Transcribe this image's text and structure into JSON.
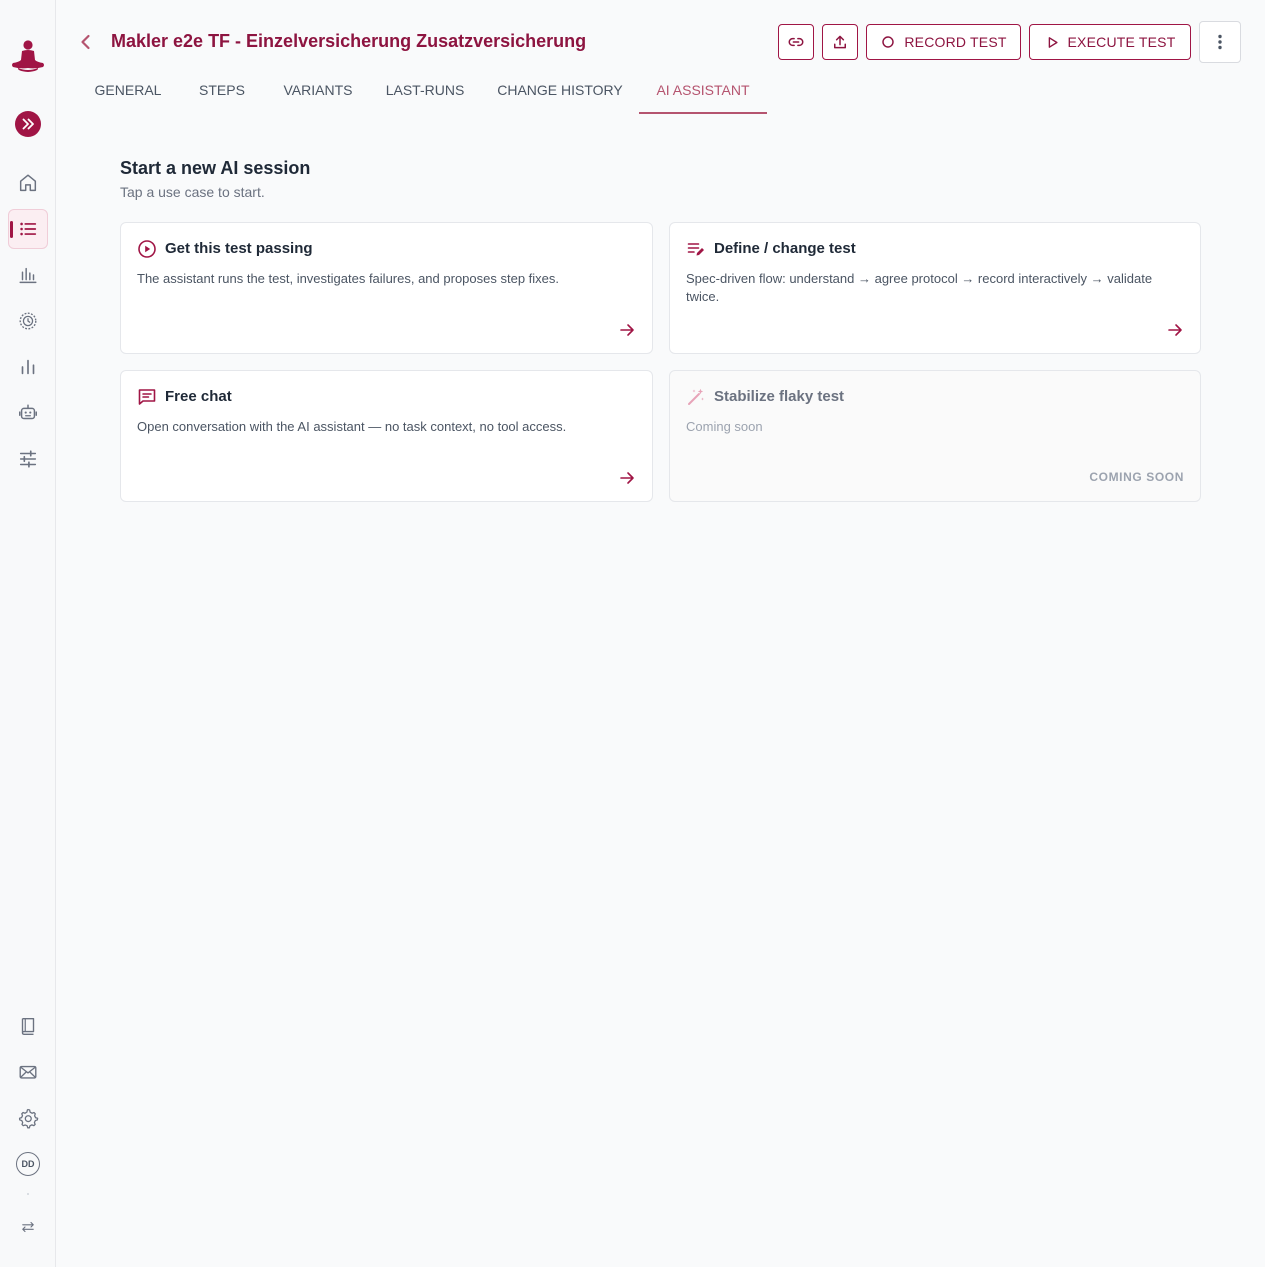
{
  "colors": {
    "brand": "#8d1440",
    "accent": "#a01545",
    "tab_active": "#b5546f",
    "icon_gray": "#6b7280"
  },
  "sidebar": {
    "logo_icon": "meditating-person-logo",
    "top_items": [
      {
        "icon": "home-icon",
        "active": false
      },
      {
        "icon": "list-icon",
        "active": true
      },
      {
        "icon": "bar-chart-icon",
        "active": false
      },
      {
        "icon": "clock-badge-icon",
        "active": false
      },
      {
        "icon": "analytics-icon",
        "active": false
      },
      {
        "icon": "robot-icon",
        "active": false
      },
      {
        "icon": "sliders-icon",
        "active": false
      }
    ],
    "bottom_items": [
      {
        "icon": "book-icon"
      },
      {
        "icon": "mail-icon"
      },
      {
        "icon": "gear-icon"
      }
    ],
    "avatar_initials": "DD"
  },
  "header": {
    "title": "Makler e2e TF - Einzelversicherung Zusatzversicherung",
    "record_label": "RECORD TEST",
    "execute_label": "EXECUTE TEST"
  },
  "tabs": [
    {
      "label": "GENERAL",
      "active": false
    },
    {
      "label": "STEPS",
      "active": false
    },
    {
      "label": "VARIANTS",
      "active": false
    },
    {
      "label": "LAST-RUNS",
      "active": false
    },
    {
      "label": "CHANGE HISTORY",
      "active": false
    },
    {
      "label": "AI ASSISTANT",
      "active": true
    }
  ],
  "main": {
    "title": "Start a new AI session",
    "subtitle": "Tap a use case to start.",
    "cards": [
      {
        "title": "Get this test passing",
        "description": "The assistant runs the test, investigates failures, and proposes step fixes.",
        "icon": "play-circle-icon",
        "enabled": true
      },
      {
        "title": "Define / change test",
        "description": "Spec-driven flow: understand → agree protocol → record interactively → validate twice.",
        "icon": "edit-list-icon",
        "enabled": true
      },
      {
        "title": "Free chat",
        "description": "Open conversation with the AI assistant — no task context, no tool access.",
        "icon": "chat-bubble-icon",
        "enabled": true
      },
      {
        "title": "Stabilize flaky test",
        "description": "Coming soon",
        "icon": "magic-wand-icon",
        "enabled": false,
        "badge": "COMING SOON"
      }
    ]
  }
}
